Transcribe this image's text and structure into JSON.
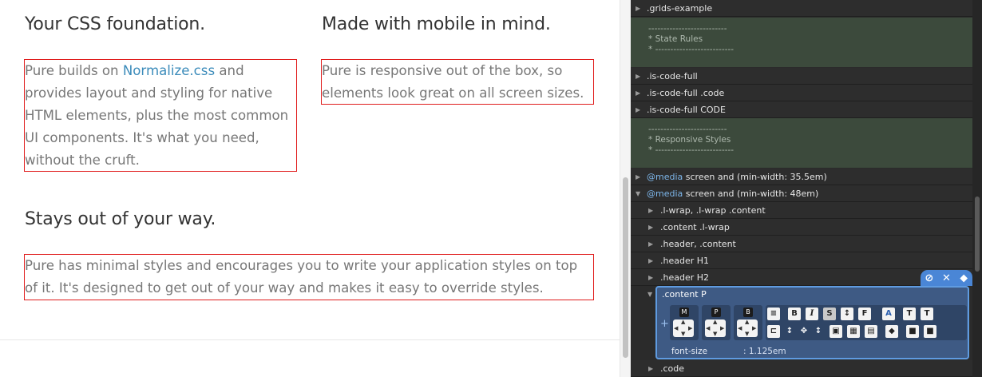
{
  "features": [
    {
      "heading": "Your CSS foundation.",
      "text_before_link": "Pure builds on ",
      "link": "Normalize.css",
      "text_after_link": " and provides layout and styling for native HTML elements, plus the most common UI components. It's what you need, without the cruft."
    },
    {
      "heading": "Made with mobile in mind.",
      "text": "Pure is responsive out of the box, so elements look great on all screen sizes."
    },
    {
      "heading": "Stays out of your way.",
      "text": "Pure has minimal styles and encourages you to write your application styles on top of it. It's designed to get out of your way and makes it easy to override styles."
    }
  ],
  "inspector": {
    "rules_top": [
      ".grids-example"
    ],
    "comment_state": "--------------------------\n* State Rules\n* --------------------------",
    "rules_mid": [
      ".is-code-full",
      ".is-code-full .code",
      ".is-code-full CODE"
    ],
    "comment_responsive": "--------------------------\n* Responsive Styles\n* --------------------------",
    "media_keyword": "@media",
    "media1": {
      "query": "screen and (min-width: 35.5em)"
    },
    "media2": {
      "query": "screen and (min-width: 48em)"
    },
    "nested_rules": [
      ".l-wrap, .l-wrap .content",
      ".content .l-wrap",
      ".header, .content",
      ".header H1",
      ".header H2"
    ],
    "editor": {
      "selector": ".content P",
      "property": "font-size",
      "value": ": 1.125em",
      "actions": [
        "⊘",
        "✕",
        "⬥"
      ]
    },
    "rules_after": [
      ".code"
    ]
  },
  "colors": {
    "link": "#3b8bba",
    "highlight_border": "#e01c1c",
    "panel_bg": "#2b2b2b",
    "editor_bg": "#3e5a84",
    "comment_bg": "#3c4a3c"
  }
}
